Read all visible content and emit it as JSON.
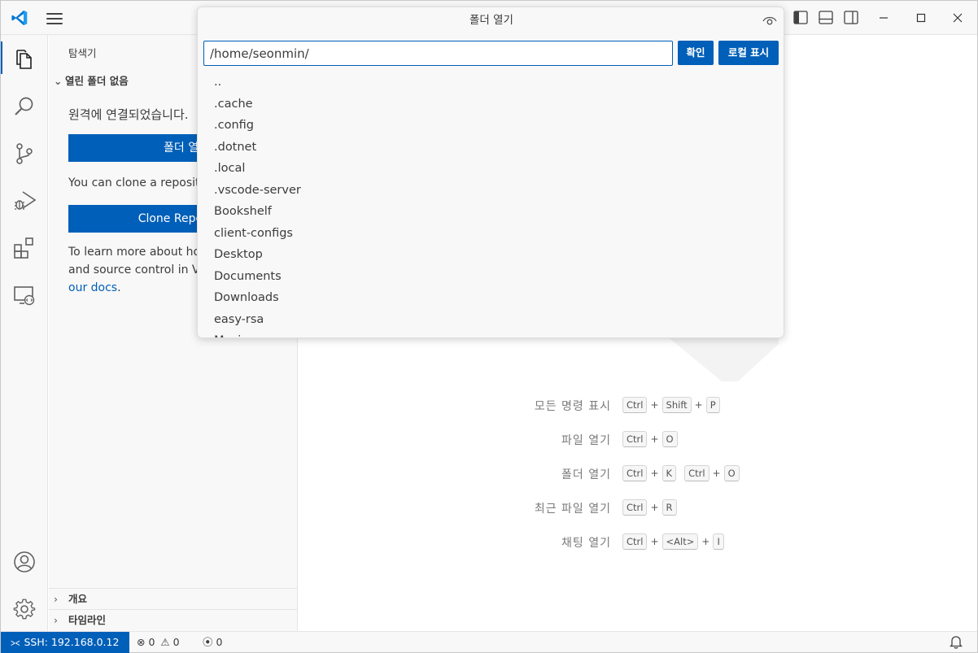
{
  "dialog": {
    "title": "폴더 열기",
    "path_value": "/home/seonmin/",
    "ok_label": "확인",
    "show_local_label": "로컬 표시",
    "folders": [
      "..",
      ".cache",
      ".config",
      ".dotnet",
      ".local",
      ".vscode-server",
      "Bookshelf",
      "client-configs",
      "Desktop",
      "Documents",
      "Downloads",
      "easy-rsa",
      "Music"
    ]
  },
  "sidebar": {
    "title": "탐색기",
    "section": "열린 폴더 없음",
    "connected_text": "원격에 연결되었습니다.",
    "open_folder_button": "폴더 열기",
    "clone_text": "You can clone a repository locally.",
    "clone_button": "Clone Repository",
    "learn_line1": "To learn more about how to use git",
    "learn_line2": "and source control in VS Code read",
    "docs_link": "our docs",
    "docs_after": ".",
    "footer_outline": "개요",
    "footer_timeline": "타임라인"
  },
  "shortcuts": [
    {
      "label": "모든 명령 표시",
      "keys": [
        [
          "Ctrl",
          "Shift",
          "P"
        ]
      ]
    },
    {
      "label": "파일 열기",
      "keys": [
        [
          "Ctrl",
          "O"
        ]
      ]
    },
    {
      "label": "폴더 열기",
      "keys": [
        [
          "Ctrl",
          "K"
        ],
        [
          "Ctrl",
          "O"
        ]
      ]
    },
    {
      "label": "최근 파일 열기",
      "keys": [
        [
          "Ctrl",
          "R"
        ]
      ]
    },
    {
      "label": "채팅 열기",
      "keys": [
        [
          "Ctrl",
          "<Alt>",
          "I"
        ]
      ]
    }
  ],
  "statusbar": {
    "remote": "SSH: 192.168.0.12",
    "errors": "0",
    "warnings": "0",
    "ports": "0"
  },
  "icons": {
    "explorer": "files-icon",
    "search": "search-icon",
    "source_control": "source-control-icon",
    "run_debug": "run-debug-icon",
    "extensions": "extensions-icon",
    "remote_explorer": "remote-explorer-icon",
    "accounts": "account-icon",
    "manage": "gear-icon"
  },
  "colors": {
    "accent": "#005fb8",
    "background": "#f8f8f8"
  }
}
